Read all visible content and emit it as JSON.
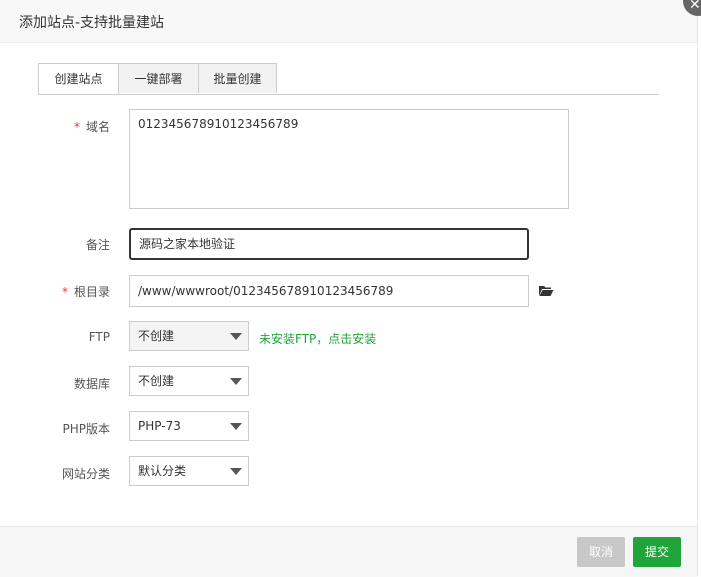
{
  "title": "添加站点-支持批量建站",
  "close_glyph": "✕",
  "tabs": [
    {
      "label": "创建站点"
    },
    {
      "label": "一键部署"
    },
    {
      "label": "批量创建"
    }
  ],
  "form": {
    "domain": {
      "label": "域名",
      "value": "012345678910123456789"
    },
    "remark": {
      "label": "备注",
      "value": "源码之家本地验证"
    },
    "root": {
      "label": "根目录",
      "value": "/www/wwwroot/012345678910123456789"
    },
    "ftp": {
      "label": "FTP",
      "selected": "不创建",
      "hint": "未安装FTP，点击安装"
    },
    "database": {
      "label": "数据库",
      "selected": "不创建"
    },
    "php": {
      "label": "PHP版本",
      "selected": "PHP-73"
    },
    "category": {
      "label": "网站分类",
      "selected": "默认分类"
    },
    "required_mark": "*"
  },
  "footer": {
    "cancel_label": "取消",
    "submit_label": "提交"
  },
  "colors": {
    "accent_green": "#20a53a",
    "required_red": "#e23d3d",
    "disabled_gray": "#c8c8c8"
  }
}
